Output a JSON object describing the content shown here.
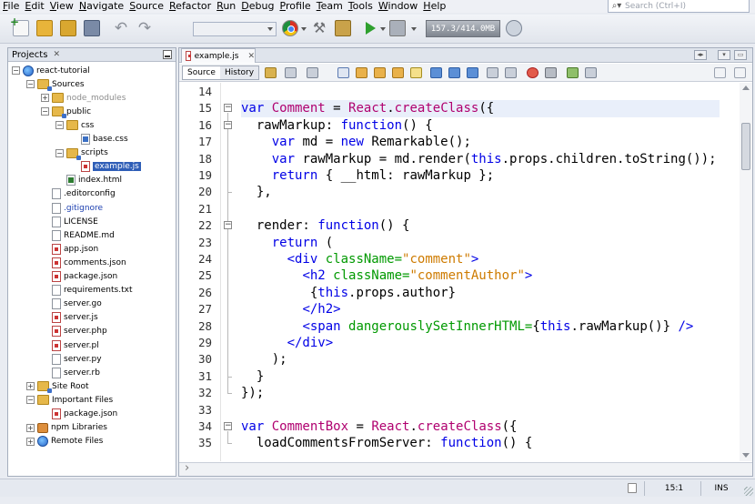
{
  "menubar": {
    "items": [
      "File",
      "Edit",
      "View",
      "Navigate",
      "Source",
      "Refactor",
      "Run",
      "Debug",
      "Profile",
      "Team",
      "Tools",
      "Window",
      "Help"
    ],
    "search_placeholder": "Search (Ctrl+I)"
  },
  "toolbar": {
    "memory": "157.3/414.0MB"
  },
  "projects": {
    "title": "Projects",
    "tree": [
      {
        "label": "react-tutorial",
        "depth": 0,
        "icon": "globe",
        "exp": "-",
        "style": ""
      },
      {
        "label": "Sources",
        "depth": 1,
        "icon": "folder-pkg",
        "exp": "-",
        "style": ""
      },
      {
        "label": "node_modules",
        "depth": 2,
        "icon": "folder",
        "exp": "+",
        "style": "gray"
      },
      {
        "label": "public",
        "depth": 2,
        "icon": "folder-pkg",
        "exp": "-",
        "style": ""
      },
      {
        "label": "css",
        "depth": 3,
        "icon": "folder",
        "exp": "-",
        "style": ""
      },
      {
        "label": "base.css",
        "depth": 4,
        "icon": "file-css",
        "exp": "",
        "style": ""
      },
      {
        "label": "scripts",
        "depth": 3,
        "icon": "folder-pkg",
        "exp": "-",
        "style": ""
      },
      {
        "label": "example.js",
        "depth": 4,
        "icon": "file-red",
        "exp": "",
        "style": "selected"
      },
      {
        "label": "index.html",
        "depth": 3,
        "icon": "file-html",
        "exp": "",
        "style": ""
      },
      {
        "label": ".editorconfig",
        "depth": 2,
        "icon": "file",
        "exp": "",
        "style": ""
      },
      {
        "label": ".gitignore",
        "depth": 2,
        "icon": "file",
        "exp": "",
        "style": "blue"
      },
      {
        "label": "LICENSE",
        "depth": 2,
        "icon": "file",
        "exp": "",
        "style": ""
      },
      {
        "label": "README.md",
        "depth": 2,
        "icon": "file",
        "exp": "",
        "style": ""
      },
      {
        "label": "app.json",
        "depth": 2,
        "icon": "file-red",
        "exp": "",
        "style": ""
      },
      {
        "label": "comments.json",
        "depth": 2,
        "icon": "file-red",
        "exp": "",
        "style": ""
      },
      {
        "label": "package.json",
        "depth": 2,
        "icon": "file-red",
        "exp": "",
        "style": ""
      },
      {
        "label": "requirements.txt",
        "depth": 2,
        "icon": "file",
        "exp": "",
        "style": ""
      },
      {
        "label": "server.go",
        "depth": 2,
        "icon": "file",
        "exp": "",
        "style": ""
      },
      {
        "label": "server.js",
        "depth": 2,
        "icon": "file-red",
        "exp": "",
        "style": ""
      },
      {
        "label": "server.php",
        "depth": 2,
        "icon": "file-red",
        "exp": "",
        "style": ""
      },
      {
        "label": "server.pl",
        "depth": 2,
        "icon": "file-red",
        "exp": "",
        "style": ""
      },
      {
        "label": "server.py",
        "depth": 2,
        "icon": "file",
        "exp": "",
        "style": ""
      },
      {
        "label": "server.rb",
        "depth": 2,
        "icon": "file",
        "exp": "",
        "style": ""
      },
      {
        "label": "Site Root",
        "depth": 1,
        "icon": "folder-pkg",
        "exp": "+",
        "style": ""
      },
      {
        "label": "Important Files",
        "depth": 1,
        "icon": "folder",
        "exp": "-",
        "style": ""
      },
      {
        "label": "package.json",
        "depth": 2,
        "icon": "file-red",
        "exp": "",
        "style": ""
      },
      {
        "label": "npm Libraries",
        "depth": 1,
        "icon": "jar",
        "exp": "+",
        "style": ""
      },
      {
        "label": "Remote Files",
        "depth": 1,
        "icon": "globe",
        "exp": "+",
        "style": ""
      }
    ]
  },
  "editor": {
    "tab_label": "example.js",
    "source_tab": "Source",
    "history_tab": "History",
    "line_numbers": [
      "14",
      "15",
      "16",
      "17",
      "18",
      "19",
      "20",
      "21",
      "22",
      "23",
      "24",
      "25",
      "26",
      "27",
      "28",
      "29",
      "30",
      "31",
      "32",
      "33",
      "34",
      "35"
    ],
    "lines": [
      [],
      [
        [
          "kw",
          "var "
        ],
        [
          "pink",
          "Comment"
        ],
        [
          "var",
          " = "
        ],
        [
          "pink",
          "React"
        ],
        [
          "var",
          "."
        ],
        [
          "pink",
          "createClass"
        ],
        [
          "var",
          "({"
        ]
      ],
      [
        [
          "var",
          "  rawMarkup: "
        ],
        [
          "kw",
          "function"
        ],
        [
          "var",
          "() {"
        ]
      ],
      [
        [
          "var",
          "    "
        ],
        [
          "kw",
          "var "
        ],
        [
          "var",
          "md = "
        ],
        [
          "kw",
          "new "
        ],
        [
          "var",
          "Remarkable();"
        ]
      ],
      [
        [
          "var",
          "    "
        ],
        [
          "kw",
          "var "
        ],
        [
          "var",
          "rawMarkup = md.render("
        ],
        [
          "kw",
          "this"
        ],
        [
          "var",
          ".props.children.toString());"
        ]
      ],
      [
        [
          "var",
          "    "
        ],
        [
          "kw",
          "return "
        ],
        [
          "var",
          "{ __html: rawMarkup };"
        ]
      ],
      [
        [
          "var",
          "  },"
        ]
      ],
      [],
      [
        [
          "var",
          "  render: "
        ],
        [
          "kw",
          "function"
        ],
        [
          "var",
          "() {"
        ]
      ],
      [
        [
          "var",
          "    "
        ],
        [
          "kw",
          "return "
        ],
        [
          "var",
          "("
        ]
      ],
      [
        [
          "var",
          "      "
        ],
        [
          "tag",
          "<div "
        ],
        [
          "attr",
          "className="
        ],
        [
          "str",
          "\"comment\""
        ],
        [
          "tag",
          ">"
        ]
      ],
      [
        [
          "var",
          "        "
        ],
        [
          "tag",
          "<h2 "
        ],
        [
          "attr",
          "className="
        ],
        [
          "str",
          "\"commentAuthor\""
        ],
        [
          "tag",
          ">"
        ]
      ],
      [
        [
          "var",
          "         {"
        ],
        [
          "kw",
          "this"
        ],
        [
          "var",
          ".props.author}"
        ]
      ],
      [
        [
          "var",
          "        "
        ],
        [
          "tag",
          "</h2>"
        ]
      ],
      [
        [
          "var",
          "        "
        ],
        [
          "tag",
          "<span "
        ],
        [
          "attr",
          "dangerouslySetInnerHTML="
        ],
        [
          "var",
          "{"
        ],
        [
          "kw",
          "this"
        ],
        [
          "var",
          ".rawMarkup()} "
        ],
        [
          "tag",
          "/>"
        ]
      ],
      [
        [
          "var",
          "      "
        ],
        [
          "tag",
          "</div>"
        ]
      ],
      [
        [
          "var",
          "    );"
        ]
      ],
      [
        [
          "var",
          "  }"
        ]
      ],
      [
        [
          "var",
          "});"
        ]
      ],
      [],
      [
        [
          "kw",
          "var "
        ],
        [
          "pink",
          "CommentBox"
        ],
        [
          "var",
          " = "
        ],
        [
          "pink",
          "React"
        ],
        [
          "var",
          "."
        ],
        [
          "pink",
          "createClass"
        ],
        [
          "var",
          "({"
        ]
      ],
      [
        [
          "var",
          "  loadCommentsFromServer: "
        ],
        [
          "kw",
          "function"
        ],
        [
          "var",
          "() {"
        ]
      ]
    ]
  },
  "statusbar": {
    "position": "15:1",
    "mode": "INS"
  }
}
